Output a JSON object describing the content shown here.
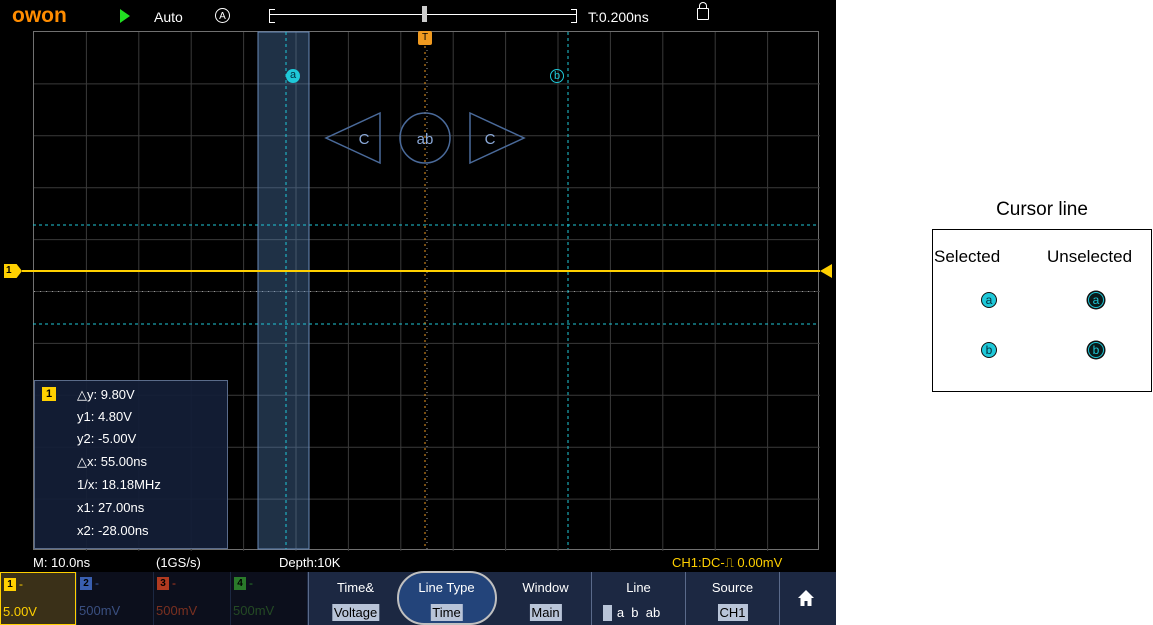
{
  "topbar": {
    "brand": "owon",
    "mode": "Auto",
    "acquire_icon_text": "A",
    "time_offset": "T:0.200ns"
  },
  "cursors": {
    "a_label": "a",
    "b_label": "b",
    "center_buttons": {
      "left_label": "C",
      "center_label": "ab",
      "right_label": "C"
    }
  },
  "markers": {
    "trigger_label": "T",
    "channel_label": "1"
  },
  "measurement": {
    "channel": "1",
    "lines": [
      "△y: 9.80V",
      "y1: 4.80V",
      "y2: -5.00V",
      "△x: 55.00ns",
      "1/x: 18.18MHz",
      "x1: 27.00ns",
      "x2: -28.00ns"
    ]
  },
  "status": {
    "timebase": "M: 10.0ns",
    "sample_rate": "(1GS/s)",
    "depth": "Depth:10K",
    "trigger": "CH1:DC-⎍ 0.00mV"
  },
  "channels": [
    {
      "num": "1",
      "dash": "-",
      "volts": "5.00V",
      "color": "#ffd000",
      "active": true
    },
    {
      "num": "2",
      "dash": "-",
      "volts": "500mV",
      "color": "#3a5fb0",
      "active": false
    },
    {
      "num": "3",
      "dash": "-",
      "volts": "500mV",
      "color": "#b03a20",
      "active": false
    },
    {
      "num": "4",
      "dash": "-",
      "volts": "500mV",
      "color": "#2a7a2a",
      "active": false
    }
  ],
  "softkeys": [
    {
      "label": "Time&",
      "value": "Voltage"
    },
    {
      "label": "Line Type",
      "value": "Time"
    },
    {
      "label": "Window",
      "value": "Main"
    },
    {
      "label": "Line",
      "value": "a  b  ab"
    },
    {
      "label": "Source",
      "value": "CH1"
    }
  ],
  "legend": {
    "title": "Cursor line",
    "selected_header": "Selected",
    "unselected_header": "Unselected",
    "a": "a",
    "b": "b"
  },
  "colors": {
    "channel1": "#ffd000",
    "cursor": "#1fc8d8",
    "trigger": "#f09a20",
    "brand": "#ff8c00"
  }
}
